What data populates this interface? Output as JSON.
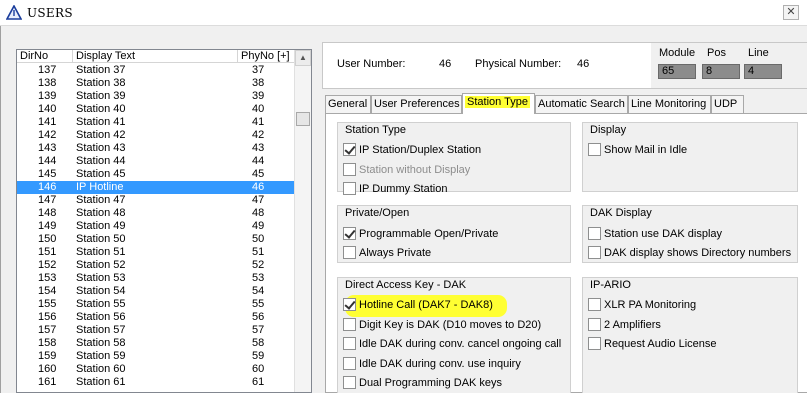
{
  "window": {
    "title": "USERS",
    "logo_icon": "triangle-logo-icon",
    "close_icon": "close-icon"
  },
  "list": {
    "columns": [
      "DirNo",
      "Display Text",
      "PhyNo [+]"
    ],
    "rows": [
      {
        "dirno": "137",
        "text": "Station 37",
        "phyno": "37"
      },
      {
        "dirno": "138",
        "text": "Station 38",
        "phyno": "38"
      },
      {
        "dirno": "139",
        "text": "Station 39",
        "phyno": "39"
      },
      {
        "dirno": "140",
        "text": "Station 40",
        "phyno": "40"
      },
      {
        "dirno": "141",
        "text": "Station 41",
        "phyno": "41"
      },
      {
        "dirno": "142",
        "text": "Station 42",
        "phyno": "42"
      },
      {
        "dirno": "143",
        "text": "Station 43",
        "phyno": "43"
      },
      {
        "dirno": "144",
        "text": "Station 44",
        "phyno": "44"
      },
      {
        "dirno": "145",
        "text": "Station 45",
        "phyno": "45"
      },
      {
        "dirno": "146",
        "text": "IP Hotline",
        "phyno": "46",
        "selected": true
      },
      {
        "dirno": "147",
        "text": "Station 47",
        "phyno": "47"
      },
      {
        "dirno": "148",
        "text": "Station 48",
        "phyno": "48"
      },
      {
        "dirno": "149",
        "text": "Station 49",
        "phyno": "49"
      },
      {
        "dirno": "150",
        "text": "Station 50",
        "phyno": "50"
      },
      {
        "dirno": "151",
        "text": "Station 51",
        "phyno": "51"
      },
      {
        "dirno": "152",
        "text": "Station 52",
        "phyno": "52"
      },
      {
        "dirno": "153",
        "text": "Station 53",
        "phyno": "53"
      },
      {
        "dirno": "154",
        "text": "Station 54",
        "phyno": "54"
      },
      {
        "dirno": "155",
        "text": "Station 55",
        "phyno": "55"
      },
      {
        "dirno": "156",
        "text": "Station 56",
        "phyno": "56"
      },
      {
        "dirno": "157",
        "text": "Station 57",
        "phyno": "57"
      },
      {
        "dirno": "158",
        "text": "Station 58",
        "phyno": "58"
      },
      {
        "dirno": "159",
        "text": "Station 59",
        "phyno": "59"
      },
      {
        "dirno": "160",
        "text": "Station 60",
        "phyno": "60"
      },
      {
        "dirno": "161",
        "text": "Station 61",
        "phyno": "61"
      }
    ]
  },
  "info": {
    "user_number_label": "User Number:",
    "user_number": "46",
    "physical_number_label": "Physical Number:",
    "physical_number": "46",
    "module_label": "Module",
    "module": "65",
    "pos_label": "Pos",
    "pos": "8",
    "line_label": "Line",
    "line": "4"
  },
  "tabs": [
    "General",
    "User Preferences",
    "Station Type",
    "Automatic Search",
    "Line Monitoring",
    "UDP"
  ],
  "active_tab": "Station Type",
  "highlight_color": "#ffff33",
  "selection_color": "#3399ff",
  "groups": {
    "station_type": {
      "title": "Station Type",
      "options": [
        {
          "label": "IP Station/Duplex Station",
          "checked": true
        },
        {
          "label": "Station without Display",
          "checked": false,
          "disabled": true
        },
        {
          "label": "IP Dummy Station",
          "checked": false
        }
      ]
    },
    "display": {
      "title": "Display",
      "options": [
        {
          "label": "Show Mail in Idle",
          "checked": false
        }
      ]
    },
    "private_open": {
      "title": "Private/Open",
      "options": [
        {
          "label": "Programmable Open/Private",
          "checked": true
        },
        {
          "label": "Always Private",
          "checked": false
        }
      ]
    },
    "dak_display": {
      "title": "DAK Display",
      "options": [
        {
          "label": "Station use DAK display",
          "checked": false
        },
        {
          "label": "DAK display shows Directory numbers",
          "checked": false
        }
      ]
    },
    "dak": {
      "title": "Direct Access Key - DAK",
      "options": [
        {
          "label": "Hotline Call (DAK7 - DAK8)",
          "checked": true,
          "highlighted": true
        },
        {
          "label": "Digit Key is DAK (D10 moves to D20)",
          "checked": false
        },
        {
          "label": "Idle DAK during conv. cancel ongoing call",
          "checked": false
        },
        {
          "label": "Idle DAK during conv. use inquiry",
          "checked": false
        },
        {
          "label": "Dual Programming DAK keys",
          "checked": false
        }
      ]
    },
    "ip_ario": {
      "title": "IP-ARIO",
      "options": [
        {
          "label": "XLR PA Monitoring",
          "checked": false
        },
        {
          "label": "2 Amplifiers",
          "checked": false
        },
        {
          "label": "Request Audio License",
          "checked": false
        }
      ]
    }
  }
}
